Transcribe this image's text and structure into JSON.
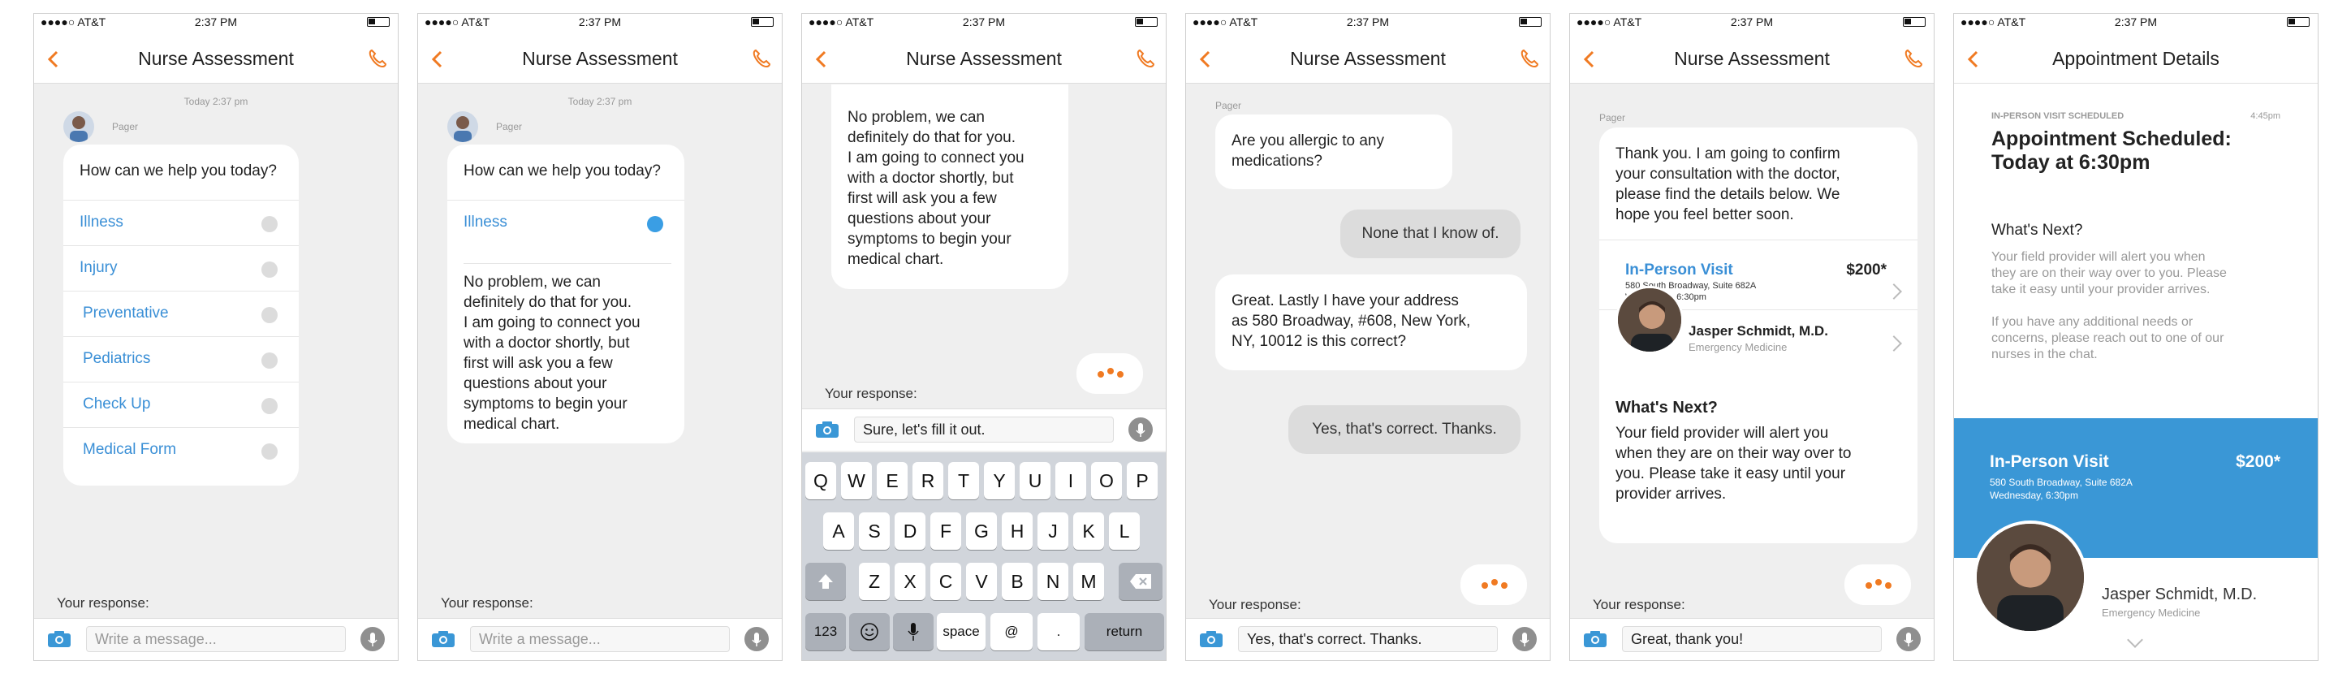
{
  "status": {
    "carrier": "●●●●○ AT&T",
    "time": "2:37 PM"
  },
  "nav": {
    "title": "Nurse Assessment",
    "appt_title": "Appointment Details"
  },
  "chat": {
    "timestamp": "Today 2:37 pm",
    "sender": "Pager",
    "question": "How can we help you today?",
    "options": [
      "Illness",
      "Injury",
      "Preventative",
      "Pediatrics",
      "Check Up",
      "Medical Form"
    ],
    "reply_lines": [
      "No problem, we can",
      "definitely do that for you.",
      "I am going to connect you",
      "with a doctor shortly, but",
      "first will ask you a few",
      "questions about your",
      "symptoms to begin your",
      "medical chart."
    ],
    "response_label": "Your response:",
    "placeholder": "Write a message...",
    "draft3": "Sure, let's fill it out.",
    "allergy_lines": [
      "Are you allergic to any",
      "medications?"
    ],
    "none": "None that I know of.",
    "address_lines": [
      "Great. Lastly I have your address",
      "as 580 Broadway, #608, New York,",
      "NY, 10012 is this correct?"
    ],
    "yes": "Yes, that's correct. Thanks.",
    "draft4": "Yes, that's correct. Thanks.",
    "confirm_lines": [
      "Thank you. I am going to confirm",
      "your consultation with the doctor,",
      "please find the details below. We",
      "hope you feel better soon."
    ],
    "visit": "In-Person Visit",
    "price": "$200*",
    "address": "580 South Broadway, Suite 682A",
    "when": "Wednesday, 6:30pm",
    "doctor": "Jasper Schmidt, M.D.",
    "specialty": "Emergency Medicine",
    "next_title": "What's Next?",
    "next_lines": [
      "Your field provider will alert you",
      "when they are on their way over to",
      "you. Please take it easy until your",
      "provider arrives."
    ],
    "draft5": "Great, thank you!"
  },
  "keyboard": {
    "row1": [
      "Q",
      "W",
      "E",
      "R",
      "T",
      "Y",
      "U",
      "I",
      "O",
      "P"
    ],
    "row2": [
      "A",
      "S",
      "D",
      "F",
      "G",
      "H",
      "J",
      "K",
      "L"
    ],
    "row3": [
      "Z",
      "X",
      "C",
      "V",
      "B",
      "N",
      "M"
    ],
    "num": "123",
    "space": "space",
    "at": "@",
    "dot": ".",
    "return": "return"
  },
  "appt": {
    "label": "IN-PERSON VISIT SCHEDULED",
    "time": "4:45pm",
    "heading1": "Appointment Scheduled:",
    "heading2": "Today at 6:30pm",
    "next": "What's Next?",
    "para1": [
      "Your field provider will alert you when",
      "they are on their way over to you. Please",
      "take it easy until your provider arrives."
    ],
    "para2": [
      "If you have any additional needs or",
      "concerns, please reach out to one of our",
      "nurses in the chat."
    ]
  },
  "colors": {
    "accent": "#f07a22",
    "link": "#3a8fd6",
    "blue": "#3a97d6"
  }
}
